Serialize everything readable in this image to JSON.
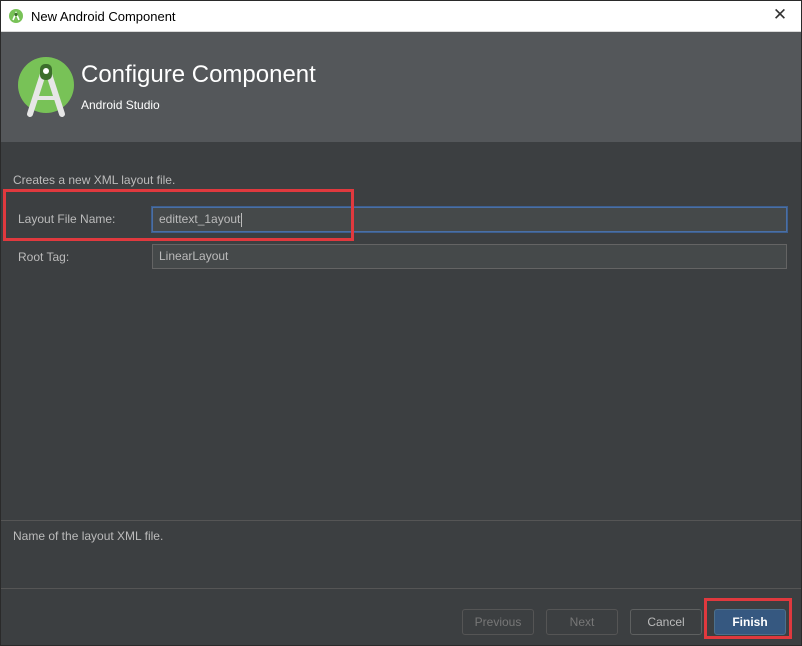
{
  "window": {
    "title": "New Android Component",
    "close_glyph": "✕"
  },
  "header": {
    "title": "Configure Component",
    "subtitle": "Android Studio",
    "logo_icon": "android-studio-logo-icon"
  },
  "body": {
    "description": "Creates a new XML layout file.",
    "fields": [
      {
        "label": "Layout File Name:",
        "value": "edittext_1ayout",
        "focused": true
      },
      {
        "label": "Root Tag:",
        "value": "LinearLayout",
        "focused": false
      }
    ],
    "help_text": "Name of the layout XML file."
  },
  "buttons": {
    "previous": "Previous",
    "next": "Next",
    "cancel": "Cancel",
    "finish": "Finish"
  },
  "colors": {
    "background": "#3c3f41",
    "header_background": "#54575a",
    "highlight": "#e0393e",
    "default_button": "#365880",
    "text": "#bbbbbb"
  }
}
